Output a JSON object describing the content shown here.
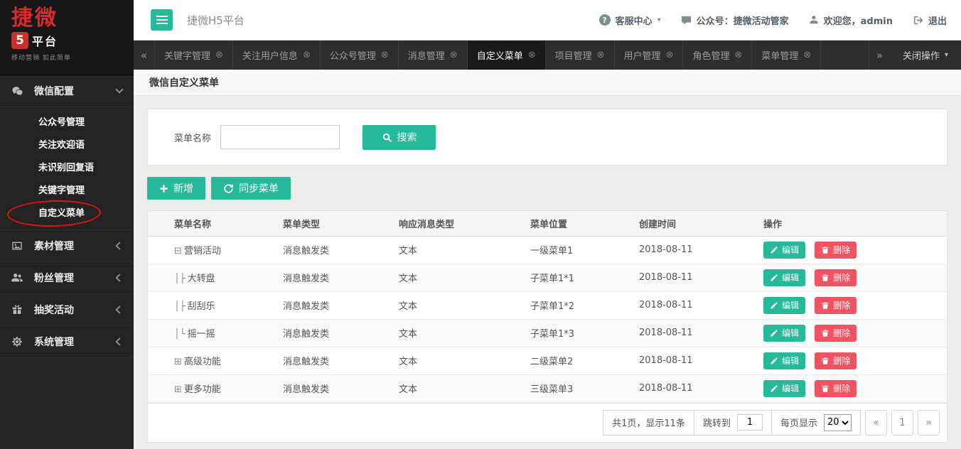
{
  "brand": {
    "logo_main": "捷微",
    "logo_badge": "5",
    "logo_suffix": "平台",
    "tagline": "移动营销 如此简单"
  },
  "topbar": {
    "title": "捷微H5平台",
    "service_center": "客服中心",
    "official_account": "公众号：捷微活动管家",
    "welcome": "欢迎您，admin",
    "logout": "退出"
  },
  "tabbar": {
    "scroll_left": "«",
    "scroll_right": "»",
    "close_menu": "关闭操作",
    "tabs": [
      {
        "label": "关键字管理",
        "active": false
      },
      {
        "label": "关注用户信息",
        "active": false
      },
      {
        "label": "公众号管理",
        "active": false
      },
      {
        "label": "消息管理",
        "active": false
      },
      {
        "label": "自定义菜单",
        "active": true
      },
      {
        "label": "项目管理",
        "active": false
      },
      {
        "label": "用户管理",
        "active": false
      },
      {
        "label": "角色管理",
        "active": false
      },
      {
        "label": "菜单管理",
        "active": false
      }
    ]
  },
  "sidebar": {
    "groups": [
      {
        "key": "wechat-config",
        "icon": "wechat-icon",
        "label": "微信配置",
        "expanded": true,
        "children": [
          {
            "key": "official-account",
            "label": "公众号管理"
          },
          {
            "key": "follow-welcome",
            "label": "关注欢迎语"
          },
          {
            "key": "unrecognized-reply",
            "label": "未识别回复语"
          },
          {
            "key": "keyword-management",
            "label": "关键字管理"
          },
          {
            "key": "custom-menu",
            "label": "自定义菜单",
            "annotated": true
          }
        ]
      },
      {
        "key": "material-management",
        "icon": "image-icon",
        "label": "素材管理",
        "expanded": false
      },
      {
        "key": "fans-management",
        "icon": "users-icon",
        "label": "粉丝管理",
        "expanded": false
      },
      {
        "key": "lottery-activity",
        "icon": "gift-icon",
        "label": "抽奖活动",
        "expanded": false
      },
      {
        "key": "system-management",
        "icon": "gear-icon",
        "label": "系统管理",
        "expanded": false
      }
    ]
  },
  "page": {
    "title": "微信自定义菜单",
    "search_label": "菜单名称",
    "search_button": "搜索",
    "add_button": "新增",
    "sync_button": "同步菜单"
  },
  "table": {
    "headers": [
      "菜单名称",
      "菜单类型",
      "响应消息类型",
      "菜单位置",
      "创建时间",
      "操作"
    ],
    "edit_label": "编辑",
    "delete_label": "删除",
    "rows": [
      {
        "tree": "⊟",
        "name": "营销活动",
        "menu_type": "消息触发类",
        "msg_type": "文本",
        "position": "一级菜单1",
        "created": "2018-08-11"
      },
      {
        "tree": "│├",
        "name": "大转盘",
        "menu_type": "消息触发类",
        "msg_type": "文本",
        "position": "子菜单1*1",
        "created": "2018-08-11"
      },
      {
        "tree": "│├",
        "name": "刮刮乐",
        "menu_type": "消息触发类",
        "msg_type": "文本",
        "position": "子菜单1*2",
        "created": "2018-08-11"
      },
      {
        "tree": "│└",
        "name": "摇一摇",
        "menu_type": "消息触发类",
        "msg_type": "文本",
        "position": "子菜单1*3",
        "created": "2018-08-11"
      },
      {
        "tree": "⊞",
        "name": "高级功能",
        "menu_type": "消息触发类",
        "msg_type": "文本",
        "position": "二级菜单2",
        "created": "2018-08-11"
      },
      {
        "tree": "⊞",
        "name": "更多功能",
        "menu_type": "消息触发类",
        "msg_type": "文本",
        "position": "三级菜单3",
        "created": "2018-08-11"
      }
    ]
  },
  "pagination": {
    "summary": "共1页，显示11条",
    "jump_label": "跳转到",
    "jump_value": "1",
    "per_page_label": "每页显示",
    "per_page_value": "20",
    "prev": "«",
    "current": "1",
    "next": "»"
  },
  "colors": {
    "accent_green": "#26b99a",
    "danger_red": "#ed5565",
    "sidebar_bg": "#232323",
    "tabbar_bg": "#2d2d2d",
    "annotation_red": "#dd1411"
  }
}
